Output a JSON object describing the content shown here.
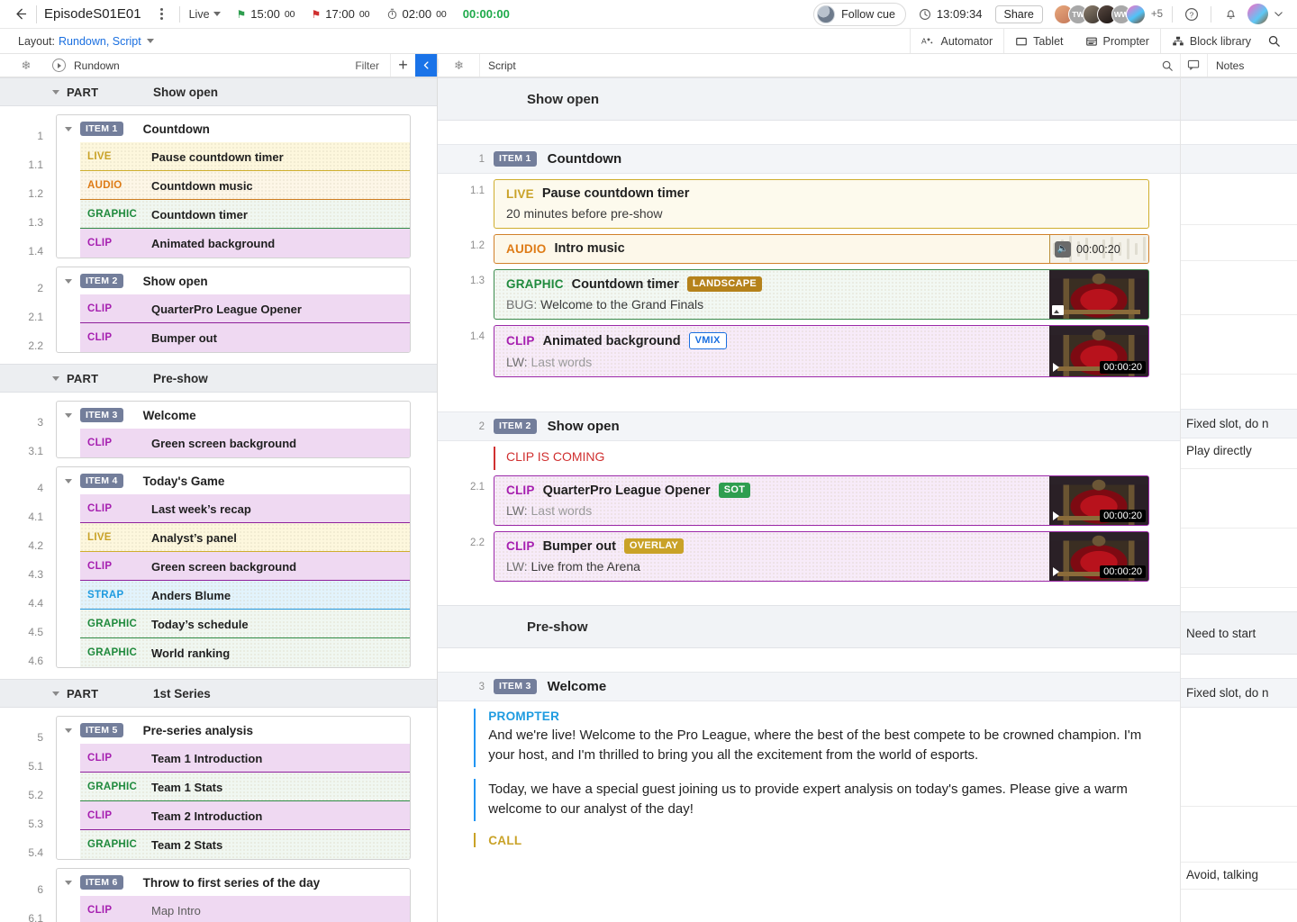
{
  "topbar": {
    "episode_title": "EpisodeS01E01",
    "mode": "Live",
    "start_time": "15:00",
    "start_time_sec": "00",
    "end_time": "17:00",
    "end_time_sec": "00",
    "duration": "02:00",
    "duration_sec": "00",
    "elapsed": "00:00:00",
    "follow_cue": "Follow cue",
    "clock": "13:09:34",
    "share": "Share",
    "avatars": [
      "",
      "TW",
      "",
      "",
      "WW",
      ""
    ],
    "more_count": "+5"
  },
  "layoutbar": {
    "label": "Layout:",
    "value": "Rundown, Script",
    "tools": [
      {
        "label": "Automator",
        "icon": "automator-icon"
      },
      {
        "label": "Tablet",
        "icon": "tablet-icon"
      },
      {
        "label": "Prompter",
        "icon": "prompter-icon"
      },
      {
        "label": "Block library",
        "icon": "block-library-icon"
      }
    ]
  },
  "rundown_panel": {
    "title": "Rundown",
    "filter": "Filter",
    "add": "+"
  },
  "script_panel": {
    "title": "Script",
    "notes_label": "Notes"
  },
  "rundown": {
    "parts": [
      {
        "kind": "PART",
        "name": "Show open",
        "items": [
          {
            "num": "1",
            "badge": "ITEM 1",
            "title": "Countdown",
            "rows": [
              {
                "num": "1.1",
                "kind": "LIVE",
                "type": "live",
                "title": "Pause countdown timer"
              },
              {
                "num": "1.2",
                "kind": "AUDIO",
                "type": "audio",
                "title": "Countdown music"
              },
              {
                "num": "1.3",
                "kind": "GRAPHIC",
                "type": "graphic",
                "title": "Countdown timer"
              },
              {
                "num": "1.4",
                "kind": "CLIP",
                "type": "clip",
                "title": "Animated background"
              }
            ]
          },
          {
            "num": "2",
            "badge": "ITEM 2",
            "title": "Show open",
            "rows": [
              {
                "num": "2.1",
                "kind": "CLIP",
                "type": "clip",
                "title": "QuarterPro League Opener"
              },
              {
                "num": "2.2",
                "kind": "CLIP",
                "type": "clip",
                "title": "Bumper out"
              }
            ]
          }
        ]
      },
      {
        "kind": "PART",
        "name": "Pre-show",
        "items": [
          {
            "num": "3",
            "badge": "ITEM 3",
            "title": "Welcome",
            "rows": [
              {
                "num": "3.1",
                "kind": "CLIP",
                "type": "clip",
                "title": "Green screen background"
              }
            ]
          },
          {
            "num": "4",
            "badge": "ITEM 4",
            "title": "Today's Game",
            "rows": [
              {
                "num": "4.1",
                "kind": "CLIP",
                "type": "clip",
                "title": "Last week’s recap"
              },
              {
                "num": "4.2",
                "kind": "LIVE",
                "type": "live",
                "title": "Analyst’s panel"
              },
              {
                "num": "4.3",
                "kind": "CLIP",
                "type": "clip",
                "title": "Green screen background"
              },
              {
                "num": "4.4",
                "kind": "STRAP",
                "type": "strap",
                "title": "Anders Blume"
              },
              {
                "num": "4.5",
                "kind": "GRAPHIC",
                "type": "graphic",
                "title": "Today’s schedule"
              },
              {
                "num": "4.6",
                "kind": "GRAPHIC",
                "type": "graphic",
                "title": "World ranking"
              }
            ]
          }
        ]
      },
      {
        "kind": "PART",
        "name": "1st Series",
        "items": [
          {
            "num": "5",
            "badge": "ITEM 5",
            "title": "Pre-series analysis",
            "rows": [
              {
                "num": "5.1",
                "kind": "CLIP",
                "type": "clip",
                "title": "Team 1 Introduction"
              },
              {
                "num": "5.2",
                "kind": "GRAPHIC",
                "type": "graphic",
                "title": "Team 1 Stats"
              },
              {
                "num": "5.3",
                "kind": "CLIP",
                "type": "clip",
                "title": "Team 2 Introduction"
              },
              {
                "num": "5.4",
                "kind": "GRAPHIC",
                "type": "graphic",
                "title": "Team 2 Stats"
              }
            ]
          },
          {
            "num": "6",
            "badge": "ITEM 6",
            "title": "Throw to first series of the day",
            "rows": [
              {
                "num": "6.1",
                "kind": "CLIP",
                "type": "clip",
                "title": "Map Intro",
                "muted": true
              }
            ]
          }
        ]
      }
    ]
  },
  "script": {
    "sections": [
      {
        "part_name": "Show open",
        "note": "",
        "items": [
          {
            "num": "1",
            "badge": "ITEM 1",
            "title": "Countdown",
            "note": "",
            "blocks": [
              {
                "num": "1.1",
                "kind": "LIVE",
                "type": "live",
                "name": "Pause countdown timer",
                "tag": "",
                "line2": "20 minutes before pre-show",
                "media": "none",
                "note": ""
              },
              {
                "num": "1.2",
                "kind": "AUDIO",
                "type": "audio",
                "name": "Intro music",
                "tag": "",
                "line2": "",
                "media": "audio",
                "duration": "00:00:20",
                "note": ""
              },
              {
                "num": "1.3",
                "kind": "GRAPHIC",
                "type": "graphic",
                "name": "Countdown timer",
                "tag": "LANDSCAPE",
                "tag_style": "landscape",
                "line2_prefix": "BUG:",
                "line2": "Welcome to the Grand Finals",
                "media": "image",
                "note": ""
              },
              {
                "num": "1.4",
                "kind": "CLIP",
                "type": "clip",
                "name": "Animated background",
                "tag": "VMIX",
                "tag_style": "vmix",
                "line2_prefix": "LW:",
                "line2": "Last words",
                "line2_muted": true,
                "media": "video",
                "duration": "00:00:20",
                "note": ""
              }
            ]
          },
          {
            "num": "2",
            "badge": "ITEM 2",
            "title": "Show open",
            "note": "Fixed slot, do n",
            "warning": "CLIP IS COMING",
            "warning_note": "Play directly",
            "blocks": [
              {
                "num": "2.1",
                "kind": "CLIP",
                "type": "clip",
                "name": "QuarterPro League Opener",
                "tag": "SOT",
                "tag_style": "sot",
                "line2_prefix": "LW:",
                "line2": "Last words",
                "line2_muted": true,
                "media": "video",
                "duration": "00:00:20",
                "note": ""
              },
              {
                "num": "2.2",
                "kind": "CLIP",
                "type": "clip",
                "name": "Bumper out",
                "tag": "OVERLAY",
                "tag_style": "overlay",
                "line2_prefix": "LW:",
                "line2": "Live from the Arena",
                "media": "video",
                "duration": "00:00:20",
                "note": ""
              }
            ]
          }
        ]
      },
      {
        "part_name": "Pre-show",
        "note": "Need to start",
        "items": [
          {
            "num": "3",
            "badge": "ITEM 3",
            "title": "Welcome",
            "note": "Fixed slot, do n",
            "prompter": {
              "label": "PROMPTER",
              "paragraphs": [
                "And we're live! Welcome to the Pro League, where the best of the best compete to be crowned champion. I'm your host, and I'm thrilled to bring you all the excitement from the world of esports.",
                "Today, we have a special guest joining us to provide expert analysis on today's games. Please give a warm welcome to our analyst of the day!"
              ]
            },
            "call_label": "CALL",
            "call_note": "Avoid, talking"
          }
        ]
      }
    ]
  }
}
